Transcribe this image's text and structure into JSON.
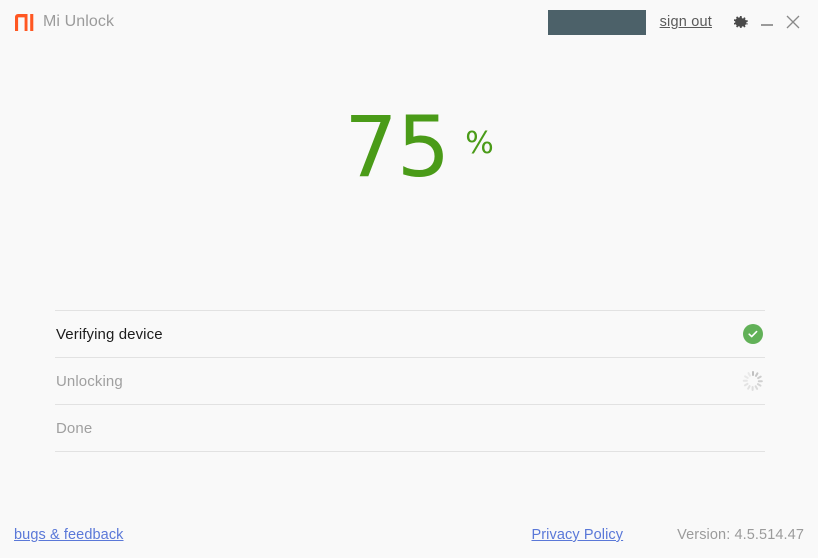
{
  "window": {
    "app_title": "Mi Unlock",
    "logo_icon": "mi-logo-icon",
    "logo_color": "#ff5722",
    "background": "#f9f9f9"
  },
  "titlebar": {
    "user_redacted_value": "",
    "redaction_color": "#4c6169",
    "sign_out_label": "sign out",
    "settings_icon": "gear-icon",
    "minimize_icon": "minimize-icon",
    "close_icon": "close-icon"
  },
  "progress": {
    "value": "75",
    "unit": "%",
    "color": "#4a9b18",
    "percent_complete": 75
  },
  "steps": [
    {
      "label": "Verifying device",
      "state": "done",
      "status_icon": "check-circle-icon"
    },
    {
      "label": "Unlocking",
      "state": "in-progress",
      "status_icon": "spinner-icon"
    },
    {
      "label": "Done",
      "state": "pending",
      "status_icon": ""
    }
  ],
  "footer": {
    "bugs_feedback_label": "bugs & feedback",
    "privacy_policy_label": "Privacy Policy",
    "version_label": "Version: 4.5.514.47",
    "link_color": "#5a78d8"
  }
}
